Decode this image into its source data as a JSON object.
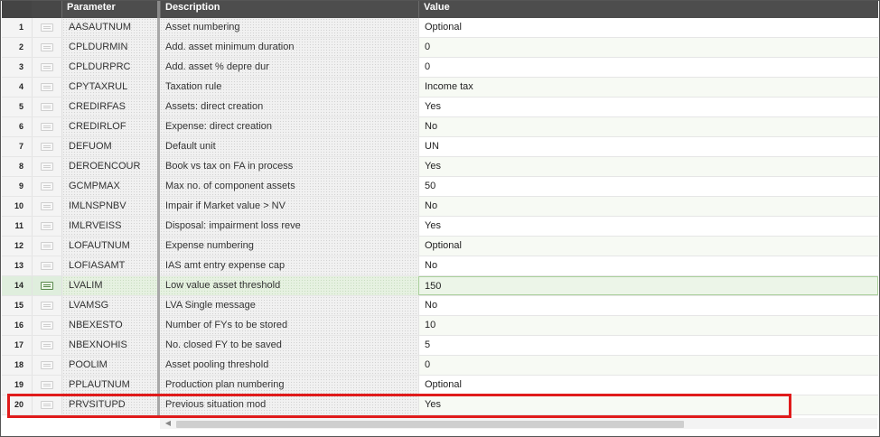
{
  "columns": {
    "param": "Parameter",
    "desc": "Description",
    "val": "Value"
  },
  "rows": [
    {
      "num": "1",
      "param": "AASAUTNUM",
      "desc": "Asset numbering",
      "val": "Optional"
    },
    {
      "num": "2",
      "param": "CPLDURMIN",
      "desc": "Add. asset minimum duration",
      "val": "0"
    },
    {
      "num": "3",
      "param": "CPLDURPRC",
      "desc": "Add. asset % depre dur",
      "val": "0"
    },
    {
      "num": "4",
      "param": "CPYTAXRUL",
      "desc": "Taxation rule",
      "val": "Income tax"
    },
    {
      "num": "5",
      "param": "CREDIRFAS",
      "desc": "Assets: direct creation",
      "val": "Yes"
    },
    {
      "num": "6",
      "param": "CREDIRLOF",
      "desc": "Expense: direct creation",
      "val": "No"
    },
    {
      "num": "7",
      "param": "DEFUOM",
      "desc": "Default unit",
      "val": "UN"
    },
    {
      "num": "8",
      "param": "DEROENCOUR",
      "desc": "Book vs tax on FA in process",
      "val": "Yes"
    },
    {
      "num": "9",
      "param": "GCMPMAX",
      "desc": "Max no. of component assets",
      "val": "50"
    },
    {
      "num": "10",
      "param": "IMLNSPNBV",
      "desc": "Impair if Market value > NV",
      "val": "No"
    },
    {
      "num": "11",
      "param": "IMLRVEISS",
      "desc": "Disposal: impairment loss reve",
      "val": "Yes"
    },
    {
      "num": "12",
      "param": "LOFAUTNUM",
      "desc": "Expense numbering",
      "val": "Optional"
    },
    {
      "num": "13",
      "param": "LOFIASAMT",
      "desc": "IAS amt entry expense cap",
      "val": "No"
    },
    {
      "num": "14",
      "param": "LVALIM",
      "desc": "Low value asset threshold",
      "val": "150"
    },
    {
      "num": "15",
      "param": "LVAMSG",
      "desc": "LVA Single message",
      "val": "No"
    },
    {
      "num": "16",
      "param": "NBEXESTO",
      "desc": "Number of FYs to be stored",
      "val": "10"
    },
    {
      "num": "17",
      "param": "NBEXNOHIS",
      "desc": "No. closed FY to be saved",
      "val": "5"
    },
    {
      "num": "18",
      "param": "POOLIM",
      "desc": "Asset pooling threshold",
      "val": "0"
    },
    {
      "num": "19",
      "param": "PPLAUTNUM",
      "desc": "Production plan numbering",
      "val": "Optional"
    },
    {
      "num": "20",
      "param": "PRVSITUPD",
      "desc": "Previous situation mod",
      "val": "Yes"
    }
  ],
  "selected_row": "14",
  "highlighted_row": "20",
  "colors": {
    "header_bg": "#4d4d4d",
    "selection_bg": "#ecf5e8",
    "highlight_border": "#e01b1b"
  },
  "icons": {
    "row_detail": "row-detail-icon",
    "scroll_left": "scroll-left-icon"
  }
}
